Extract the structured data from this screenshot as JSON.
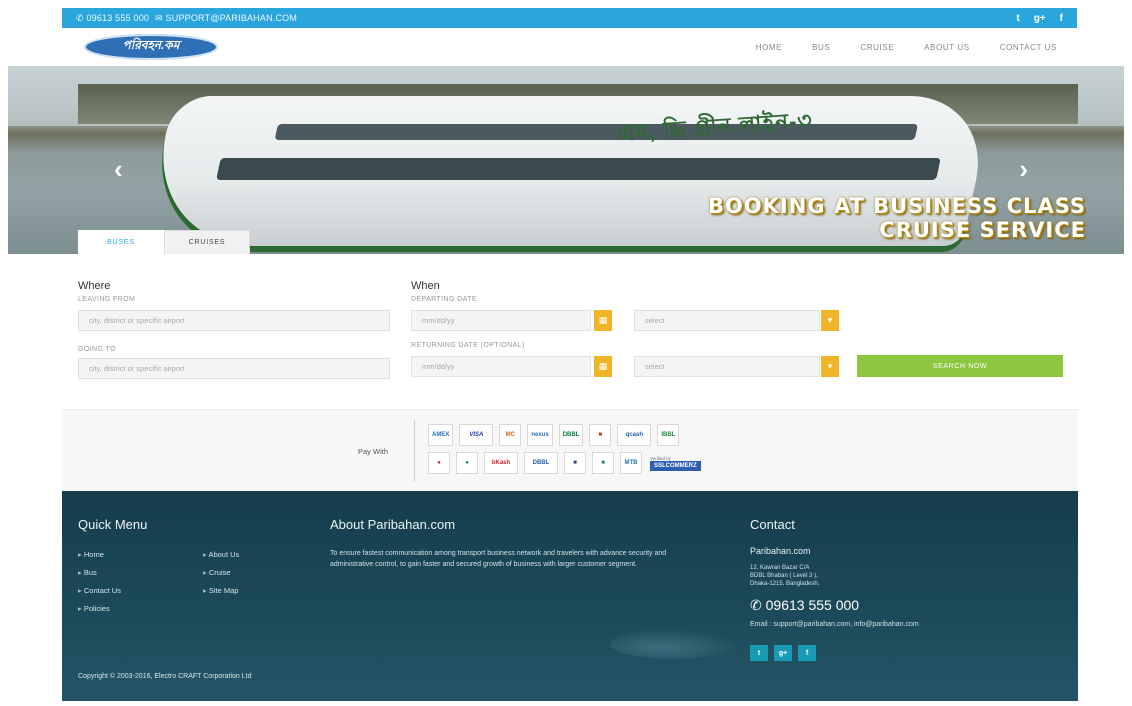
{
  "topbar": {
    "phone": "✆ 09613 555 000",
    "email": "✉ SUPPORT@PARIBAHAN.COM",
    "social": [
      "t",
      "g+",
      "f"
    ]
  },
  "header": {
    "logo_text": "পরিবহন.কম",
    "nav": [
      "HOME",
      "BUS",
      "CRUISE",
      "ABOUT US",
      "CONTACT US"
    ]
  },
  "hero": {
    "ship_name": "এম, ভি গ্রীন লাইন-৩",
    "caption_line1": "BOOKING AT BUSINESS CLASS",
    "caption_line2": "CRUISE SERVICE",
    "prev": "‹",
    "next": "›"
  },
  "tabs": [
    {
      "label": "BUSES"
    },
    {
      "label": "CRUISES"
    }
  ],
  "search": {
    "where_title": "Where",
    "when_title": "When",
    "leaving_label": "LEAVING FROM",
    "leaving_placeholder": "city, district or specific airport",
    "going_label": "GOING TO",
    "going_placeholder": "city, district or specific airport",
    "departing_label": "DEPARTING DATE",
    "departing_placeholder": "mm/dd/yy",
    "returning_label": "RETURNING DATE (OPTIONAL)",
    "returning_placeholder": "mm/dd/yy",
    "select_1": "select",
    "select_2": "select",
    "search_button": "SEARCH NOW"
  },
  "payment": {
    "label": "Pay With",
    "row1": [
      "AMEX",
      "VISA",
      "MC",
      "nexus",
      "DBBL",
      "",
      "qcash",
      "IBBL"
    ],
    "row2": [
      "",
      "",
      "bKash",
      "DBBL",
      "",
      "",
      "MTB",
      ""
    ],
    "verified_by": "Verified by",
    "ssl": "SSLCOMMERZ"
  },
  "footer": {
    "quick_menu_title": "Quick Menu",
    "quick_menu_col1": [
      "Home",
      "Bus",
      "Contact Us",
      "Policies"
    ],
    "quick_menu_col2": [
      "About Us",
      "Cruise",
      "Site Map"
    ],
    "about_title": "About Paribahan.com",
    "about_text": "To ensure fastest communication among transport business network and travelers with advance security and administrative control, to gain faster and secured growth of business with larger customer segment.",
    "contact_title": "Contact",
    "company": "Paribahan.com",
    "address_line1": "12, Kawran Bazar C/A",
    "address_line2": "BDBL Bhaban ( Level 3 ),",
    "address_line3": "Dhaka-1215, Bangladesh.",
    "phone": "✆ 09613 555 000",
    "email": "Email : support@paribahan.com, info@paribahan.com",
    "social": [
      "t",
      "g+",
      "f"
    ],
    "copyright": "Copyright © 2003-2016, Electro CRAFT Corporation Ltd"
  }
}
